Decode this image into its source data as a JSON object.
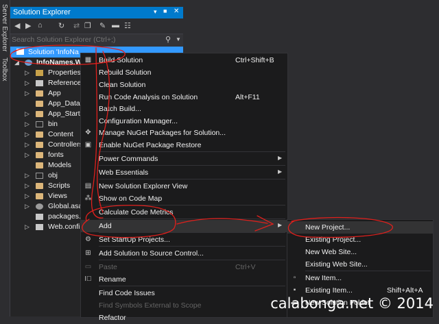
{
  "side_tabs": [
    "Server Explorer",
    "Toolbox"
  ],
  "panel": {
    "title": "Solution Explorer",
    "title_buttons": [
      "▾",
      "■",
      "✕"
    ],
    "search_placeholder": "Search Solution Explorer (Ctrl+;)"
  },
  "tree": {
    "solution": "Solution 'InfoNa",
    "project": "InfoNames.W",
    "items": [
      "Properties",
      "References",
      "App",
      "App_Data",
      "App_Start",
      "bin",
      "Content",
      "Controllers",
      "fonts",
      "Models",
      "obj",
      "Scripts",
      "Views",
      "Global.asax",
      "packages.c",
      "Web.confi"
    ]
  },
  "context_menu": {
    "items": [
      {
        "label": "Build Solution",
        "shortcut": "Ctrl+Shift+B"
      },
      {
        "label": "Rebuild Solution"
      },
      {
        "label": "Clean Solution"
      },
      {
        "label": "Run Code Analysis on Solution",
        "shortcut": "Alt+F11"
      },
      {
        "label": "Batch Build..."
      },
      {
        "label": "Configuration Manager..."
      },
      {
        "label": "Manage NuGet Packages for Solution..."
      },
      {
        "label": "Enable NuGet Package Restore"
      },
      {
        "label": "Power Commands"
      },
      {
        "label": "Web Essentials"
      },
      {
        "label": "New Solution Explorer View"
      },
      {
        "label": "Show on Code Map"
      },
      {
        "label": "Calculate Code Metrics"
      },
      {
        "label": "Add"
      },
      {
        "label": "Set StartUp Projects..."
      },
      {
        "label": "Add Solution to Source Control..."
      },
      {
        "label": "Paste",
        "shortcut": "Ctrl+V"
      },
      {
        "label": "Rename"
      },
      {
        "label": "Find Code Issues"
      },
      {
        "label": "Find Symbols External to Scope"
      },
      {
        "label": "Refactor"
      }
    ]
  },
  "add_submenu": {
    "items": [
      {
        "label": "New Project..."
      },
      {
        "label": "Existing Project..."
      },
      {
        "label": "New Web Site..."
      },
      {
        "label": "Existing Web Site..."
      },
      {
        "label": "New Item..."
      },
      {
        "label": "Existing Item...",
        "shortcut": "Shift+Alt+A"
      },
      {
        "label": "New Solution Folder"
      }
    ]
  },
  "watermark": "calabonga.net © 2014",
  "colors": {
    "accent": "#007acc",
    "background": "#2d2d30",
    "menu": "#1b1b1c",
    "annotation": "#e0201c"
  }
}
